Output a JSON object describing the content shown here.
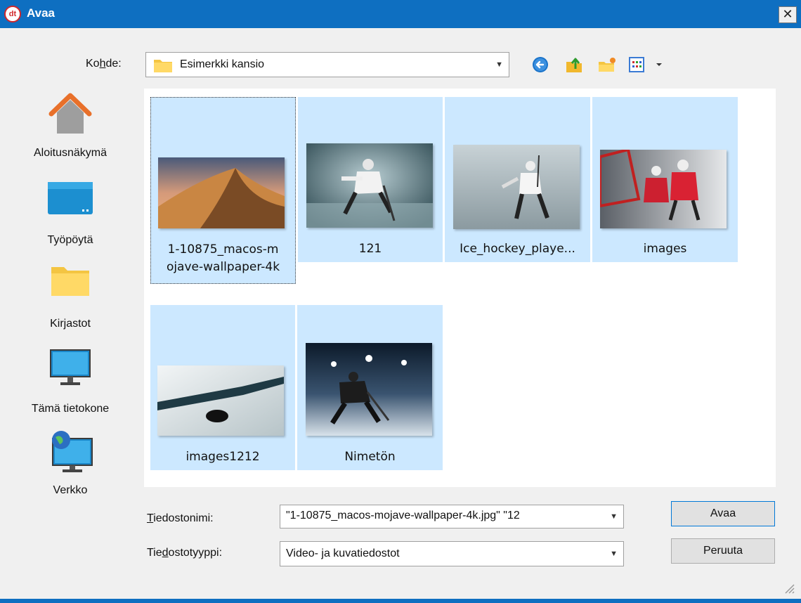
{
  "window": {
    "title": "Avaa",
    "logo_text": "dt",
    "close_glyph": "✕",
    "accent_color": "#0e6fc1",
    "selection_color": "#cce8ff"
  },
  "location": {
    "label": "Kohde:",
    "value": "Esimerkki kansio"
  },
  "toolbar": {
    "icons": [
      "back-icon",
      "up-folder-icon",
      "new-folder-icon",
      "view-menu-icon"
    ]
  },
  "sidebar": {
    "items": [
      {
        "label": "Aloitusnäkymä",
        "icon": "home-icon"
      },
      {
        "label": "Työpöytä",
        "icon": "desktop-icon"
      },
      {
        "label": "Kirjastot",
        "icon": "libraries-folder-icon"
      },
      {
        "label": "Tämä tietokone",
        "icon": "computer-icon"
      },
      {
        "label": "Verkko",
        "icon": "network-icon"
      }
    ]
  },
  "files": [
    {
      "name_line1": "1-10875_macos-m",
      "name_line2": "ojave-wallpaper-4k"
    },
    {
      "name_line1": "121"
    },
    {
      "name_line1": "Ice_hockey_playe..."
    },
    {
      "name_line1": "images"
    },
    {
      "name_line1": "images1212"
    },
    {
      "name_line1": "Nimetön"
    }
  ],
  "filename": {
    "label": "Tiedostonimi:",
    "value": "\"1-10875_macos-mojave-wallpaper-4k.jpg\" \"12"
  },
  "filetype": {
    "label": "Tiedostotyyppi:",
    "value": "Video- ja kuvatiedostot"
  },
  "buttons": {
    "open": "Avaa",
    "cancel": "Peruuta"
  }
}
